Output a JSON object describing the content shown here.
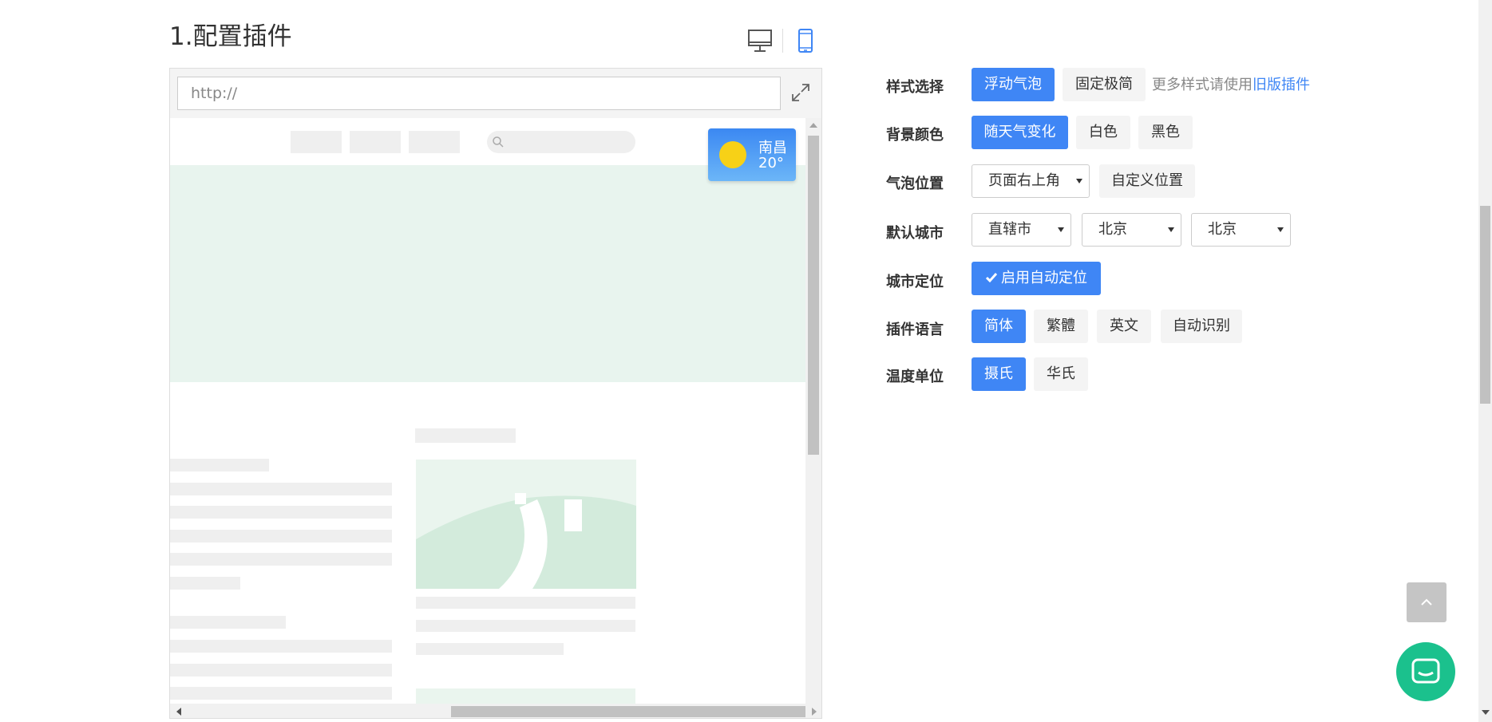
{
  "section": {
    "title": "1.配置插件"
  },
  "device_toggle": {
    "desktop_icon": "desktop-icon",
    "mobile_icon": "mobile-icon"
  },
  "preview": {
    "url_placeholder": "http://",
    "widget": {
      "city": "南昌",
      "temp": "20°"
    }
  },
  "config": {
    "style": {
      "label": "样式选择",
      "options": [
        "浮动气泡",
        "固定极简"
      ],
      "selected": "浮动气泡",
      "more_text": "更多样式请使用",
      "more_link": "旧版插件"
    },
    "bg_color": {
      "label": "背景颜色",
      "options": [
        "随天气变化",
        "白色",
        "黑色"
      ],
      "selected": "随天气变化"
    },
    "position": {
      "label": "气泡位置",
      "select_value": "页面右上角",
      "custom_label": "自定义位置"
    },
    "default_city": {
      "label": "默认城市",
      "province": "直辖市",
      "city": "北京",
      "district": "北京"
    },
    "locate": {
      "label": "城市定位",
      "button": "启用自动定位"
    },
    "language": {
      "label": "插件语言",
      "options": [
        "简体",
        "繁體",
        "英文",
        "自动识别"
      ],
      "selected": "简体"
    },
    "temp_unit": {
      "label": "温度单位",
      "options": [
        "摄氏",
        "华氏"
      ],
      "selected": "摄氏"
    }
  },
  "colors": {
    "accent": "#3f86f5",
    "chat": "#1bc18d",
    "widget_top": "#3b88f2",
    "widget_bottom": "#6cb6f8",
    "sun": "#f7d117"
  }
}
